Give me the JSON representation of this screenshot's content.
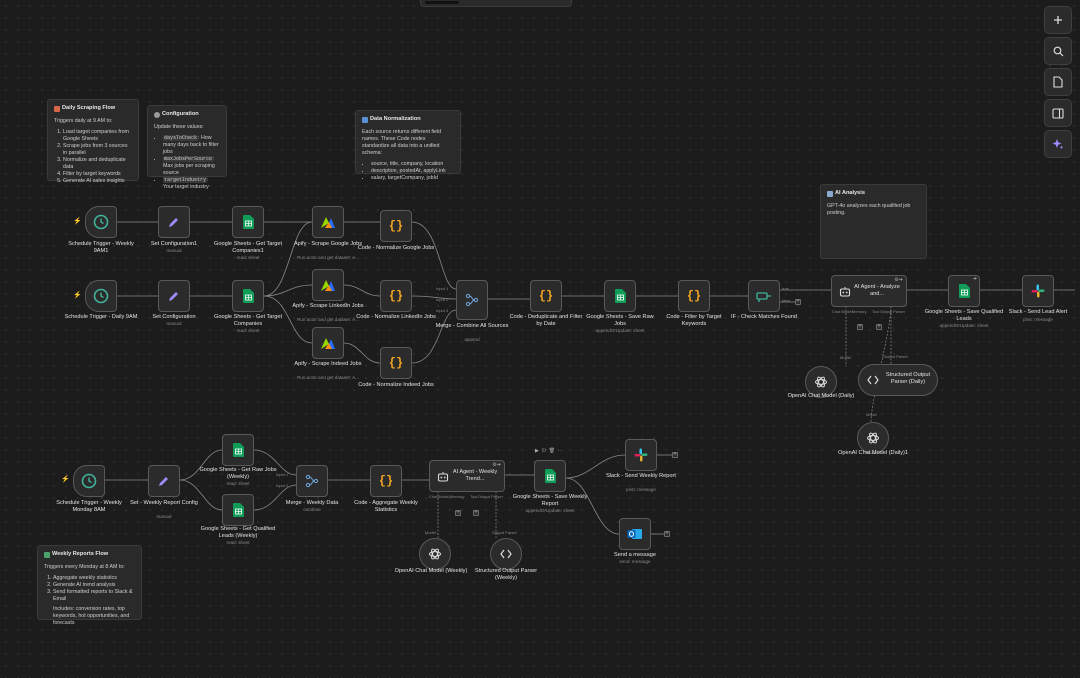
{
  "stickies": {
    "daily": {
      "title": "Daily Scraping Flow",
      "intro": "Triggers daily at 9 AM to:",
      "items": [
        "Load target companies from Google Sheets",
        "Scrape jobs from 3 sources in parallel",
        "Normalize and deduplicate data",
        "Filter by target keywords",
        "Generate AI sales insights"
      ]
    },
    "config": {
      "title": "Configuration",
      "intro": "Update these values:",
      "items": [
        {
          "code": "daysToCheck",
          "text": ": How many days back to filter jobs"
        },
        {
          "code": "maxJobsPerSource",
          "text": ": Max jobs per scraping source"
        },
        {
          "code": "targetIndustry",
          "text": ": Your target industry"
        }
      ]
    },
    "normalization": {
      "title": "Data Normalization",
      "intro": "Each source returns different field names. These Code nodes standardize all data into a unified schema:",
      "items": [
        "source, title, company, location",
        "description, postedAt, applyLink",
        "salary, targetCompany, jobId"
      ]
    },
    "ai": {
      "title": "AI Analysis",
      "intro": "GPT-4o analyzes each qualified job posting."
    },
    "weekly": {
      "title": "Weekly Reports Flow",
      "intro": "Triggers every Monday at 8 AM to:",
      "items": [
        "Aggregate weekly statistics",
        "Generate AI trend analysis",
        "Send formatted reports to Slack & Email"
      ],
      "note": "Includes: conversion rates, top keywords, hot opportunities, and forecasts"
    }
  },
  "nodes": {
    "sched_weekly": {
      "label": "Schedule Trigger - Weekly 9AM1"
    },
    "set_config1": {
      "label": "Set Configuration1",
      "sub": "manual"
    },
    "gs_target1": {
      "label": "Google Sheets - Get Target Companies1",
      "sub": "read: sheet"
    },
    "apify_google": {
      "label": "Apify - Scrape Google Jobs",
      "sub": "Run actor and get dataset: A..."
    },
    "code_google": {
      "label": "Code - Normalize Google Jobs"
    },
    "sched_daily": {
      "label": "Schedule Trigger - Daily 9AM"
    },
    "set_config": {
      "label": "Set Configuration",
      "sub": "manual"
    },
    "gs_target": {
      "label": "Google Sheets - Get Target Companies",
      "sub": "read: sheet"
    },
    "apify_linkedin": {
      "label": "Apify - Scrape LinkedIn Jobs",
      "sub": "Run actor and get dataset: A..."
    },
    "code_linkedin": {
      "label": "Code - Normalize LinkedIn Jobs"
    },
    "apify_indeed": {
      "label": "Apify - Scrape Indeed Jobs",
      "sub": "Run actor and get dataset: A..."
    },
    "code_indeed": {
      "label": "Code - Normalize Indeed Jobs"
    },
    "merge_all": {
      "label": "Merge - Combine All Sources",
      "sub": "append",
      "inputs": [
        "Input 1",
        "Input 2",
        "Input 3"
      ]
    },
    "code_dedup": {
      "label": "Code - Deduplicate and Filter by Date"
    },
    "gs_save_raw": {
      "label": "Google Sheets - Save Raw Jobs",
      "sub": "appendOrUpdate: sheet"
    },
    "code_filter": {
      "label": "Code - Filter by Target Keywords"
    },
    "if_check": {
      "label": "IF - Check Matches Found",
      "true_label": "true",
      "false_label": "false"
    },
    "agent_daily": {
      "label": "AI Agent - Analyze and...",
      "ports": [
        "Chat Model",
        "Memory",
        "Tool",
        "Output Parser"
      ]
    },
    "gs_save_qual": {
      "label": "Google Sheets - Save Qualified Leads",
      "sub": "appendOrUpdate: sheet"
    },
    "slack_alert": {
      "label": "Slack - Send Lead Alert",
      "sub": "post: message"
    },
    "openai_daily": {
      "label": "OpenAI Chat Model (Daily)",
      "port": "Model"
    },
    "parser_daily": {
      "label": "Structured Output Parser (Daily)",
      "port": "Output Parser"
    },
    "openai_daily1": {
      "label": "OpenAI Chat Model (Daily)1",
      "port": "Model"
    },
    "sched_monday": {
      "label": "Schedule Trigger - Weekly Monday 8AM"
    },
    "set_report": {
      "label": "Set - Weekly Report Config",
      "sub": "manual"
    },
    "gs_raw_weekly": {
      "label": "Google Sheets - Get Raw Jobs (Weekly)",
      "sub": "read: sheet"
    },
    "gs_qual_weekly": {
      "label": "Google Sheets - Get Qualified Leads (Weekly)",
      "sub": "read: sheet"
    },
    "merge_weekly": {
      "label": "Merge - Weekly Data",
      "sub": "combine",
      "inputs": [
        "Input 1",
        "Input 2"
      ]
    },
    "code_aggregate": {
      "label": "Code - Aggregate Weekly Statistics"
    },
    "agent_weekly": {
      "label": "AI Agent - Weekly Trend...",
      "ports": [
        "Chat Model",
        "Memory",
        "Tool",
        "Output Parser"
      ]
    },
    "gs_save_weekly": {
      "label": "Google Sheets - Save Weekly Report",
      "sub": "appendOrUpdate: sheet"
    },
    "slack_weekly": {
      "label": "Slack - Send Weekly Report",
      "sub": "post: message"
    },
    "send_message": {
      "label": "Send a message",
      "sub": "send: message"
    },
    "openai_weekly": {
      "label": "OpenAI Chat Model (Weekly)",
      "port": "Model"
    },
    "parser_weekly": {
      "label": "Structured Output Parser (Weekly)",
      "port": "Output Parser"
    }
  },
  "icons": {
    "schedule": "clock-icon",
    "set": "pencil-icon",
    "sheets": "google-sheets-icon",
    "apify": "apify-icon",
    "code": "code-braces-icon",
    "merge": "merge-icon",
    "if": "if-icon",
    "agent": "robot-icon",
    "slack": "slack-icon",
    "openai": "openai-icon",
    "parser": "parser-icon",
    "outlook": "outlook-icon"
  },
  "sidebar": [
    "add-node",
    "search",
    "templates",
    "toggle-panel",
    "ai-assistant"
  ],
  "colors": {
    "canvas": "#1c1c1c",
    "node": "#2b2b2b",
    "trigger_bolt": "#ff6d5a",
    "sheets": "#0f9d58",
    "code": "#f5a623",
    "merge": "#6fa8dc",
    "set": "#9d8cf5",
    "ai": "#a18cff"
  }
}
